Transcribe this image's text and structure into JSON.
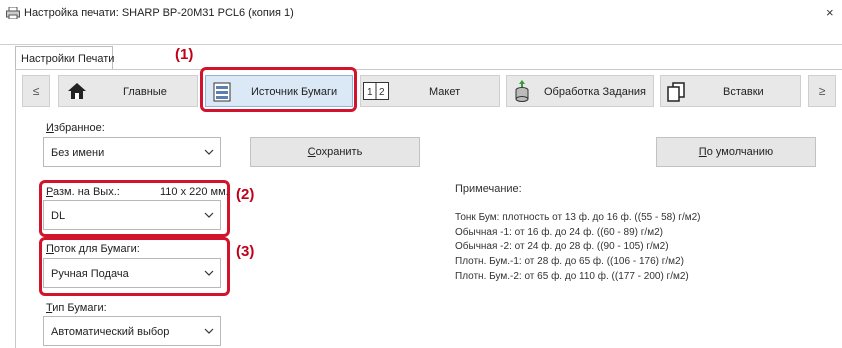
{
  "window": {
    "title": "Настройка печати: SHARP BP-20M31 PCL6 (копия 1)",
    "close": "×"
  },
  "tabs": {
    "active": "Настройки Печати"
  },
  "nav": {
    "prev": "≤",
    "next": "≥",
    "items": [
      {
        "label": "Главные",
        "icon": "home-icon"
      },
      {
        "label": "Источник Бумаги",
        "icon": "paper-tray-icon"
      },
      {
        "label": "Макет",
        "icon": "layout-icon"
      },
      {
        "label": "Обработка Задания",
        "icon": "job-handling-icon"
      },
      {
        "label": "Вставки",
        "icon": "inserts-icon"
      }
    ]
  },
  "callouts": {
    "c1": "(1)",
    "c2": "(2)",
    "c3": "(3)"
  },
  "favorites": {
    "label": "Избранное:",
    "value": "Без имени",
    "save": "Сохранить",
    "default": "По умолчанию"
  },
  "output_size": {
    "label": "Разм. на Вых.:",
    "dims": "110 x 220 мм.",
    "value": "DL"
  },
  "paper_source": {
    "label": "Поток для Бумаги:",
    "value": "Ручная Подача"
  },
  "paper_type": {
    "label": "Тип Бумаги:",
    "value": "Автоматический выбор"
  },
  "note": {
    "title": "Примечание:",
    "lines": [
      "Тонк Бум: плотность от 13 ф. до 16 ф. ((55 - 58) г/м2)",
      "Обычная -1: от 16 ф. до 24 ф. ((60 - 89) г/м2)",
      "Обычная -2: от 24 ф. до 28 ф. ((90 - 105) г/м2)",
      "Плотн. Бум.-1: от 28 ф. до 65 ф. ((106 - 176) г/м2)",
      "Плотн. Бум.-2: от 65 ф. до 110 ф. ((177 - 200) г/м2)"
    ]
  },
  "colors": {
    "highlight": "#d3132c",
    "callout": "#c00018",
    "nav_bg": "#e8e8e8",
    "selected_bg": "#dbe9f7"
  }
}
